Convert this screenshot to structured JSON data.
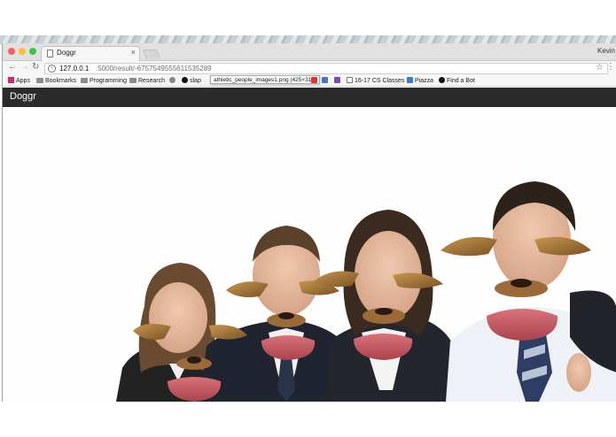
{
  "browser": {
    "tab_title": "Doggr",
    "tab_close": "×",
    "profile_name": "Kevin",
    "url_host": "127.0.0.1",
    "url_rest": ":5000/result/-6757549555611535289",
    "tooltip": "athletic_people_images1.png (425×317)",
    "traffic_lights": [
      "#fc605b",
      "#fdbc40",
      "#34c84a"
    ]
  },
  "bookmarks": {
    "apps": "Apps",
    "bookmarks": "Bookmarks",
    "programming": "Programming",
    "research": "Research",
    "slap": "slap",
    "cs_classes": "16-17 CS Classes",
    "piazza": "Piazza",
    "find_bot": "Find a Bot"
  },
  "app": {
    "brand": "Doggr",
    "navbar_color": "#2b2b2b"
  },
  "result": {
    "image": "athletic_people_images1.png",
    "people_count": 4,
    "filter": "dog ears, nose and tongue"
  }
}
